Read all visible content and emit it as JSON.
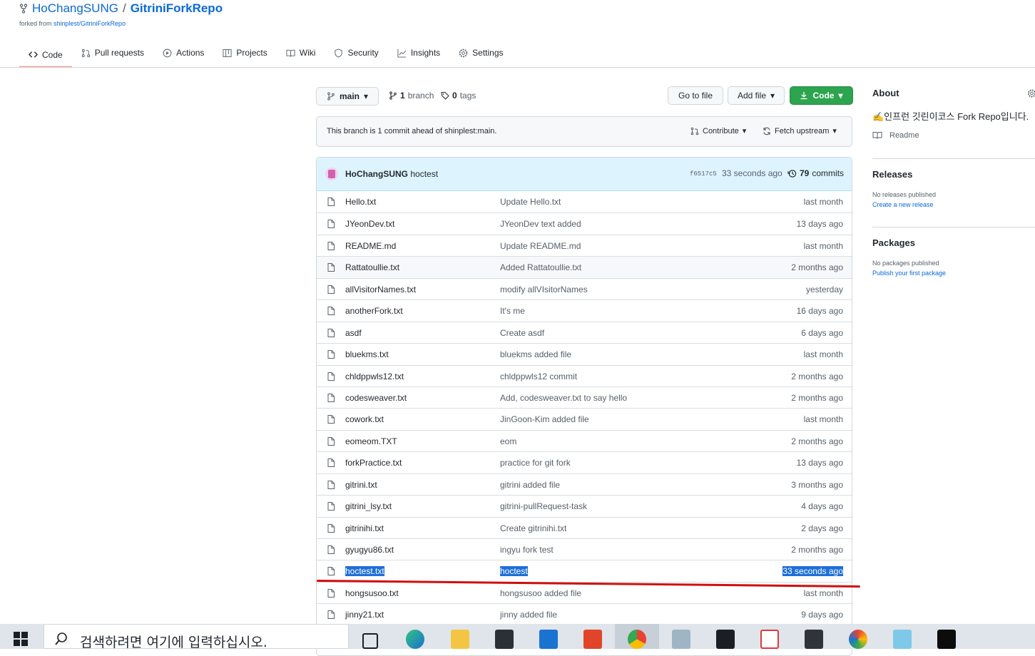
{
  "repo": {
    "owner": "HoChangSUNG",
    "separator": "/",
    "name": "GitriniForkRepo",
    "forked_from_prefix": "forked from",
    "forked_from": "shinplest/GitriniForkRepo"
  },
  "tabs": [
    {
      "label": "Code",
      "icon": "code-icon",
      "selected": true
    },
    {
      "label": "Pull requests",
      "icon": "pull-request-icon"
    },
    {
      "label": "Actions",
      "icon": "play-icon"
    },
    {
      "label": "Projects",
      "icon": "table-icon"
    },
    {
      "label": "Wiki",
      "icon": "book-icon"
    },
    {
      "label": "Security",
      "icon": "shield-icon"
    },
    {
      "label": "Insights",
      "icon": "graph-icon"
    },
    {
      "label": "Settings",
      "icon": "gear-icon"
    }
  ],
  "branch_bar": {
    "branch": "main",
    "branch_count": "1",
    "branch_label": "branch",
    "tag_count": "0",
    "tag_label": "tags",
    "go_to_file": "Go to file",
    "add_file": "Add file",
    "code": "Code"
  },
  "ahead": {
    "text": "This branch is 1 commit ahead of shinplest:main.",
    "contribute": "Contribute",
    "fetch": "Fetch upstream"
  },
  "latest_commit": {
    "author": "HoChangSUNG",
    "message": "hoctest",
    "sha": "f6517c5",
    "time": "33 seconds ago",
    "count": "79",
    "count_label": "commits"
  },
  "files": [
    {
      "name": "Hello.txt",
      "message": "Update Hello.txt",
      "time": "last month"
    },
    {
      "name": "JYeonDev.txt",
      "message": "JYeonDev text added",
      "time": "13 days ago"
    },
    {
      "name": "README.md",
      "message": "Update README.md",
      "time": "last month"
    },
    {
      "name": "Rattatoullie.txt",
      "message": "Added Rattatoullie.txt",
      "time": "2 months ago"
    },
    {
      "name": "allVisitorNames.txt",
      "message": "modify allVIsitorNames",
      "time": "yesterday"
    },
    {
      "name": "anotherFork.txt",
      "message": "It's me",
      "time": "16 days ago"
    },
    {
      "name": "asdf",
      "message": "Create asdf",
      "time": "6 days ago"
    },
    {
      "name": "bluekms.txt",
      "message": "bluekms added file",
      "time": "last month"
    },
    {
      "name": "chldppwls12.txt",
      "message": "chldppwls12 commit",
      "time": "2 months ago"
    },
    {
      "name": "codesweaver.txt",
      "message": "Add, codesweaver.txt to say hello",
      "time": "2 months ago"
    },
    {
      "name": "cowork.txt",
      "message": "JinGoon-Kim added file",
      "time": "last month"
    },
    {
      "name": "eomeom.TXT",
      "message": "eom",
      "time": "2 months ago"
    },
    {
      "name": "forkPractice.txt",
      "message": "practice for git fork",
      "time": "13 days ago"
    },
    {
      "name": "gitrini.txt",
      "message": "gitrini added file",
      "time": "3 months ago"
    },
    {
      "name": "gitrini_lsy.txt",
      "message": "gitrini-pullRequest-task",
      "time": "4 days ago"
    },
    {
      "name": "gitrinihi.txt",
      "message": "Create gitrinihi.txt",
      "time": "2 days ago"
    },
    {
      "name": "gyugyu86.txt",
      "message": "ingyu fork test",
      "time": "2 months ago"
    },
    {
      "name": "hoctest.txt",
      "message": "hoctest",
      "time": "33 seconds ago",
      "selected": true
    },
    {
      "name": "hongsusoo.txt",
      "message": "hongsusoo added file",
      "time": "last month"
    },
    {
      "name": "jinny21.txt",
      "message": "jinny added file",
      "time": "9 days ago"
    }
  ],
  "sidebar": {
    "about_title": "About",
    "description": "✍인프런 깃린이코스 Fork Repo입니다.",
    "readme": "Readme",
    "releases_title": "Releases",
    "releases_empty": "No releases published",
    "releases_link": "Create a new release",
    "packages_title": "Packages",
    "packages_empty": "No packages published",
    "packages_link": "Publish your first package"
  },
  "taskbar": {
    "search_placeholder": "검색하려면 여기에 입력하십시오.",
    "apps": [
      "task-view-icon",
      "edge-icon",
      "file-explorer-icon",
      "store-icon",
      "mail-icon",
      "office-icon",
      "chrome-icon",
      "recycle-icon",
      "pycharm-icon",
      "sync-icon",
      "sticky-notes-icon",
      "color-app-icon",
      "notepad-icon",
      "terminal-icon"
    ]
  },
  "colors": {
    "link": "#0969da",
    "green_button": "#2da44e",
    "selection": "#1e6fd9",
    "annotation_red": "#d10e0e"
  }
}
